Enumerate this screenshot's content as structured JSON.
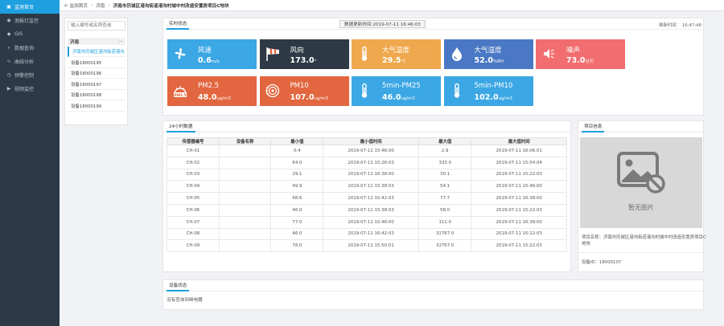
{
  "sidebar": {
    "items": [
      {
        "label": "监测首页",
        "icon": "home-icon",
        "active": true
      },
      {
        "label": "测报灯监控",
        "icon": "lamp-icon"
      },
      {
        "label": "GIS",
        "icon": "map-icon"
      },
      {
        "label": "数据查询",
        "icon": "search-icon"
      },
      {
        "label": "曲线分析",
        "icon": "curve-icon"
      },
      {
        "label": "预警控制",
        "icon": "alarm-icon"
      },
      {
        "label": "视频监控",
        "icon": "video-icon"
      }
    ]
  },
  "breadcrumb": {
    "home": "监测首页",
    "level1": "济南",
    "current": "济南市历城区港沟街道港沟村城中村改造安置房项目C地块"
  },
  "tree": {
    "search_placeholder": "输入编号或名称查询",
    "group": "济南",
    "collapse": "—",
    "items": [
      "济南市历城区港沟街道港沟",
      "设备18000195",
      "设备18000196",
      "设备18000197",
      "设备18000198",
      "设备18000199"
    ]
  },
  "realtime": {
    "tab": "实时状态",
    "update_time": "数据更新时间:2019-07-11 16:46:03",
    "refresh_label": "刷新时间：",
    "refresh_time": "16:47:48",
    "cards": [
      {
        "label": "风速",
        "value": "0.6",
        "unit": "m/s",
        "color": "#3ba7e4",
        "icon": "fan-icon"
      },
      {
        "label": "风向",
        "value": "173.0",
        "unit": "°",
        "color": "#2d3a45",
        "icon": "windsock-icon"
      },
      {
        "label": "大气温度",
        "value": "29.5",
        "unit": "℃",
        "color": "#efa84d",
        "icon": "thermometer-icon"
      },
      {
        "label": "大气湿度",
        "value": "52.0",
        "unit": "%RH",
        "color": "#4a78c4",
        "icon": "droplet-icon"
      },
      {
        "label": "噪声",
        "value": "73.0",
        "unit": "分贝",
        "color": "#f16d6f",
        "icon": "speaker-icon"
      },
      {
        "label": "PM2.5",
        "value": "48.0",
        "unit": "ug/m3",
        "color": "#e2663f",
        "icon": "pm25-icon",
        "icon_text": "PM2.5"
      },
      {
        "label": "PM10",
        "value": "107.0",
        "unit": "ug/m3",
        "color": "#e2663f",
        "icon": "pm10-icon"
      },
      {
        "label": "5min-PM25",
        "value": "46.0",
        "unit": "ug/m3",
        "color": "#3ba7e4",
        "icon": "thermometer-icon"
      },
      {
        "label": "5min-PM10",
        "value": "102.0",
        "unit": "ug/m3",
        "color": "#3ba7e4",
        "icon": "thermometer-icon"
      }
    ]
  },
  "hist": {
    "tab": "24小时数据",
    "headers": [
      "传感器编号",
      "设备名称",
      "最小值",
      "最小值时间",
      "最大值",
      "最大值时间"
    ],
    "rows": [
      [
        "CH-01",
        "",
        "0.4",
        "2019-07-11 15:46:00",
        "2.9",
        "2019-07-11 16:06:01"
      ],
      [
        "CH-02",
        "",
        "64.0",
        "2019-07-11 15:26:03",
        "333.0",
        "2019-07-11 15:54:04"
      ],
      [
        "CH-03",
        "",
        "29.1",
        "2019-07-11 16:38:00",
        "30.1",
        "2019-07-11 15:22:03"
      ],
      [
        "CH-04",
        "",
        "49.9",
        "2019-07-11 15:38:03",
        "54.1",
        "2019-07-11 15:46:00"
      ],
      [
        "CH-05",
        "",
        "68.6",
        "2019-07-11 15:42:03",
        "77.7",
        "2019-07-11 16:38:00"
      ],
      [
        "CH-06",
        "",
        "46.0",
        "2019-07-11 15:38:03",
        "58.0",
        "2019-07-11 15:22:03"
      ],
      [
        "CH-07",
        "",
        "77.0",
        "2019-07-11 15:46:00",
        "111.0",
        "2019-07-11 16:38:00"
      ],
      [
        "CH-08",
        "",
        "46.0",
        "2019-07-11 16:42:03",
        "32767.0",
        "2019-07-11 15:22:03"
      ],
      [
        "CH-09",
        "",
        "78.0",
        "2019-07-11 15:50:01",
        "32767.0",
        "2019-07-11 15:22:03"
      ]
    ]
  },
  "project": {
    "tab": "项目信息",
    "no_image": "暂无图片",
    "name_line": "项目名称：济南市历城区港沟街道港沟村城中村改造安置房项目C地块",
    "device_id": "设备ID：18000107"
  },
  "device_status": {
    "tab": "设备状态",
    "message": "没有查询到继电器"
  }
}
